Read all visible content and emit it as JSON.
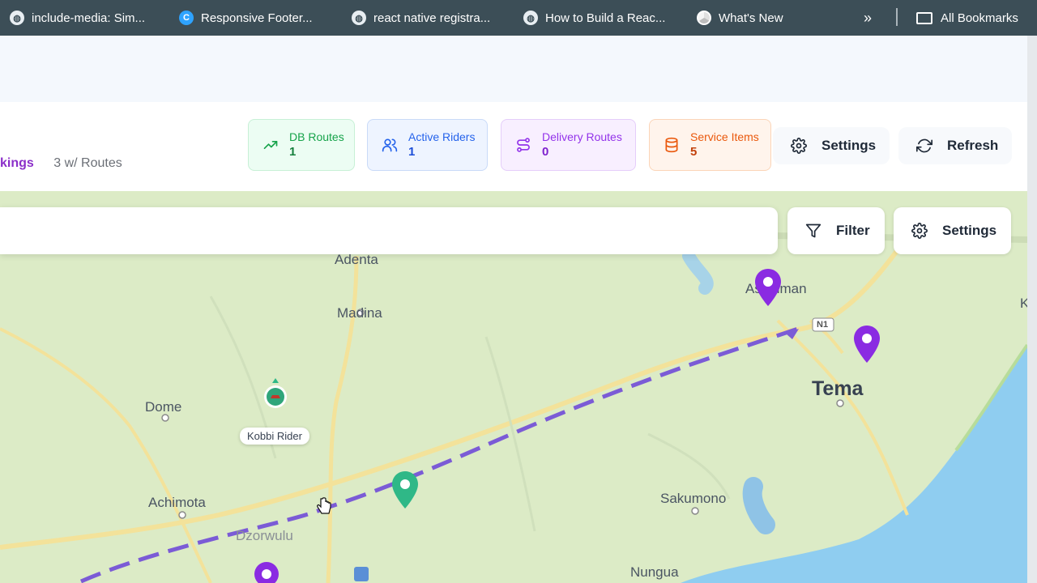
{
  "bookmarks": {
    "items": [
      {
        "label": "include-media: Sim...",
        "icon": "globe-icon"
      },
      {
        "label": "Responsive Footer...",
        "icon": "c-logo-icon"
      },
      {
        "label": "react native registra...",
        "icon": "globe-icon"
      },
      {
        "label": "How to Build a Reac...",
        "icon": "globe-icon"
      },
      {
        "label": "What's New",
        "icon": "chrome-icon"
      }
    ],
    "overflow": "»",
    "all_bookmarks": "All Bookmarks"
  },
  "header": {
    "tab_label": "kings",
    "tab_count": "3 w/ Routes"
  },
  "stats": [
    {
      "label": "DB Routes",
      "value": "1",
      "color": "#16a34a",
      "bg": "#ecfdf3",
      "border": "#c7f0d6",
      "icon": "trending-up-icon"
    },
    {
      "label": "Active Riders",
      "value": "1",
      "color": "#2563eb",
      "bg": "#eef4ff",
      "border": "#c9daf8",
      "icon": "users-icon"
    },
    {
      "label": "Delivery Routes",
      "value": "0",
      "color": "#9333ea",
      "bg": "#f8efff",
      "border": "#e5cdfa",
      "icon": "route-icon"
    },
    {
      "label": "Service Items",
      "value": "5",
      "color": "#ea580c",
      "bg": "#fff4ec",
      "border": "#fbd5b8",
      "icon": "database-icon"
    }
  ],
  "actions": {
    "settings": "Settings",
    "refresh": "Refresh"
  },
  "map": {
    "filter": "Filter",
    "settings": "Settings",
    "places": [
      "Adenta",
      "Madina",
      "Ashaiman",
      "Tema",
      "Dome",
      "Achimota",
      "Dzorwulu",
      "Sakumono",
      "Nungua",
      "K"
    ],
    "road_badge": "N1",
    "rider_label": "Kobbi Rider"
  }
}
